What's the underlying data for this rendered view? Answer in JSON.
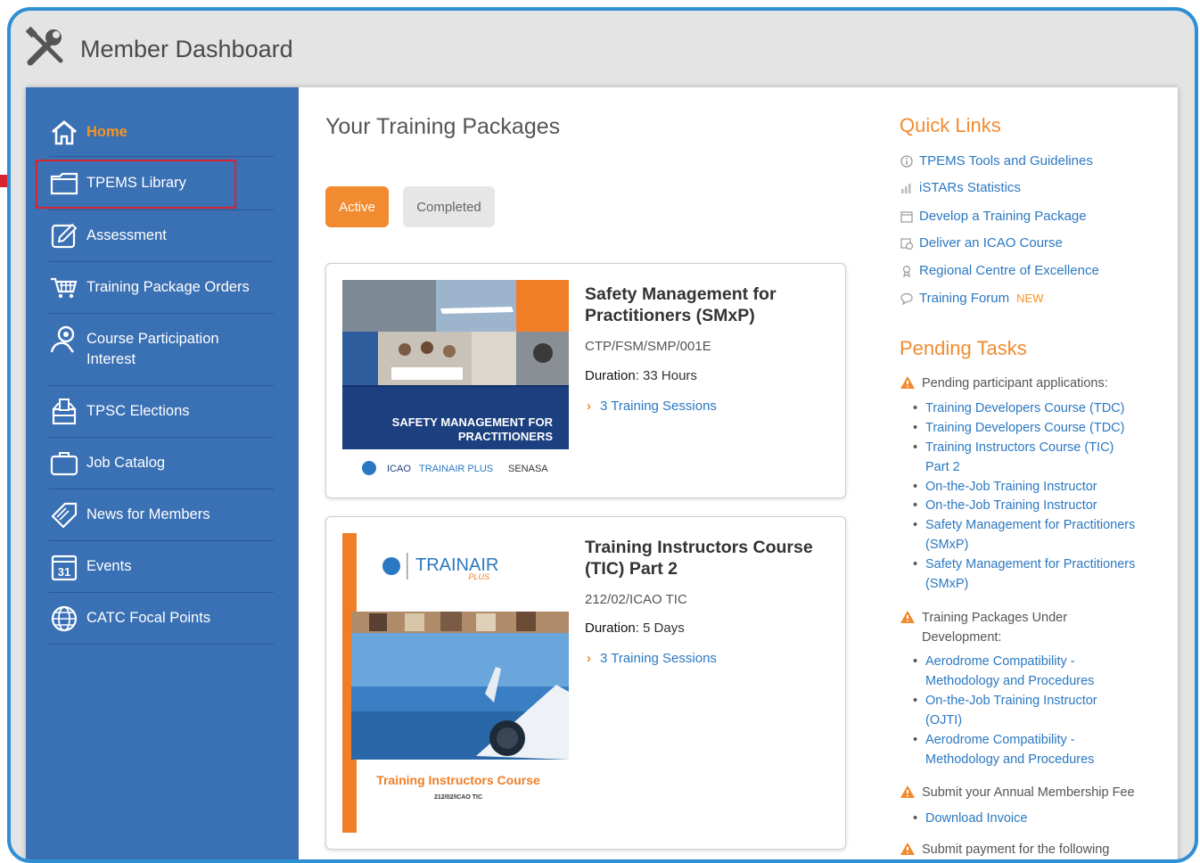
{
  "header": {
    "title": "Member Dashboard",
    "icon": "tools-icon"
  },
  "sidebar": {
    "items": [
      {
        "label": "Home",
        "icon": "home-icon"
      },
      {
        "label": "TPEMS Library",
        "icon": "folder-icon"
      },
      {
        "label": "Assessment",
        "icon": "edit-icon"
      },
      {
        "label": "Training Package Orders",
        "icon": "cart-icon"
      },
      {
        "label": "Course Participation Interest",
        "icon": "person-icon"
      },
      {
        "label": "TPSC Elections",
        "icon": "ballot-icon"
      },
      {
        "label": "Job Catalog",
        "icon": "briefcase-icon"
      },
      {
        "label": "News for Members",
        "icon": "tag-icon"
      },
      {
        "label": "Events",
        "icon": "calendar-icon",
        "calendar_day": "31"
      },
      {
        "label": "CATC Focal Points",
        "icon": "globe-icon"
      }
    ]
  },
  "main": {
    "heading": "Your Training Packages",
    "tabs": {
      "active": "Active",
      "completed": "Completed"
    },
    "cards": [
      {
        "title": "Safety Management for Practitioners (SMxP)",
        "code": "CTP/FSM/SMP/001E",
        "duration_label": "Duration",
        "duration_value": ": 33 Hours",
        "sessions": "3 Training Sessions",
        "cover_caption": "SAFETY MANAGEMENT FOR PRACTITIONERS",
        "cover_logos": [
          "ICAO",
          "TRAINAIR PLUS",
          "SENASA"
        ]
      },
      {
        "title": "Training Instructors Course (TIC) Part 2",
        "code": "212/02/ICAO TIC",
        "duration_label": "Duration",
        "duration_value": ": 5 Days",
        "sessions": "3 Training Sessions",
        "cover_brand": "TRAINAIR",
        "cover_brand_sub": "PLUS",
        "cover_caption": "Training Instructors Course",
        "cover_subcaption": "212/02/ICAO TIC"
      }
    ]
  },
  "quick_links": {
    "heading": "Quick Links",
    "items": [
      {
        "label": "TPEMS Tools and Guidelines",
        "icon": "info-icon"
      },
      {
        "label": "iSTARs Statistics",
        "icon": "bar-chart-icon"
      },
      {
        "label": "Develop a Training Package",
        "icon": "calendar-icon"
      },
      {
        "label": "Deliver an ICAO Course",
        "icon": "calendar-clock-icon"
      },
      {
        "label": "Regional Centre of Excellence",
        "icon": "award-icon"
      },
      {
        "label": "Training Forum",
        "icon": "chat-icon",
        "badge": "NEW"
      }
    ]
  },
  "pending_tasks": {
    "heading": "Pending Tasks",
    "groups": [
      {
        "label": "Pending participant applications:",
        "items": [
          "Training Developers Course (TDC)",
          "Training Developers Course (TDC)",
          "Training Instructors Course (TIC) Part 2",
          "On-the-Job Training Instructor",
          "On-the-Job Training Instructor",
          "Safety Management for Practitioners (SMxP)",
          "Safety Management for Practitioners (SMxP)"
        ]
      },
      {
        "label": "Training Packages Under Development:",
        "items": [
          "Aerodrome Compatibility - Methodology and Procedures",
          "On-the-Job Training Instructor (OJTI)",
          "Aerodrome Compatibility - Methodology and Procedures"
        ]
      },
      {
        "label": "Submit your Annual Membership Fee",
        "items": [
          "Download Invoice"
        ]
      },
      {
        "label": "Submit payment for the following",
        "items": []
      }
    ]
  },
  "colors": {
    "sidebar": "#3a70b4",
    "accent": "#f28a30",
    "link": "#2b78c2",
    "frame": "#2f8fd3",
    "highlight": "#d9232e"
  }
}
